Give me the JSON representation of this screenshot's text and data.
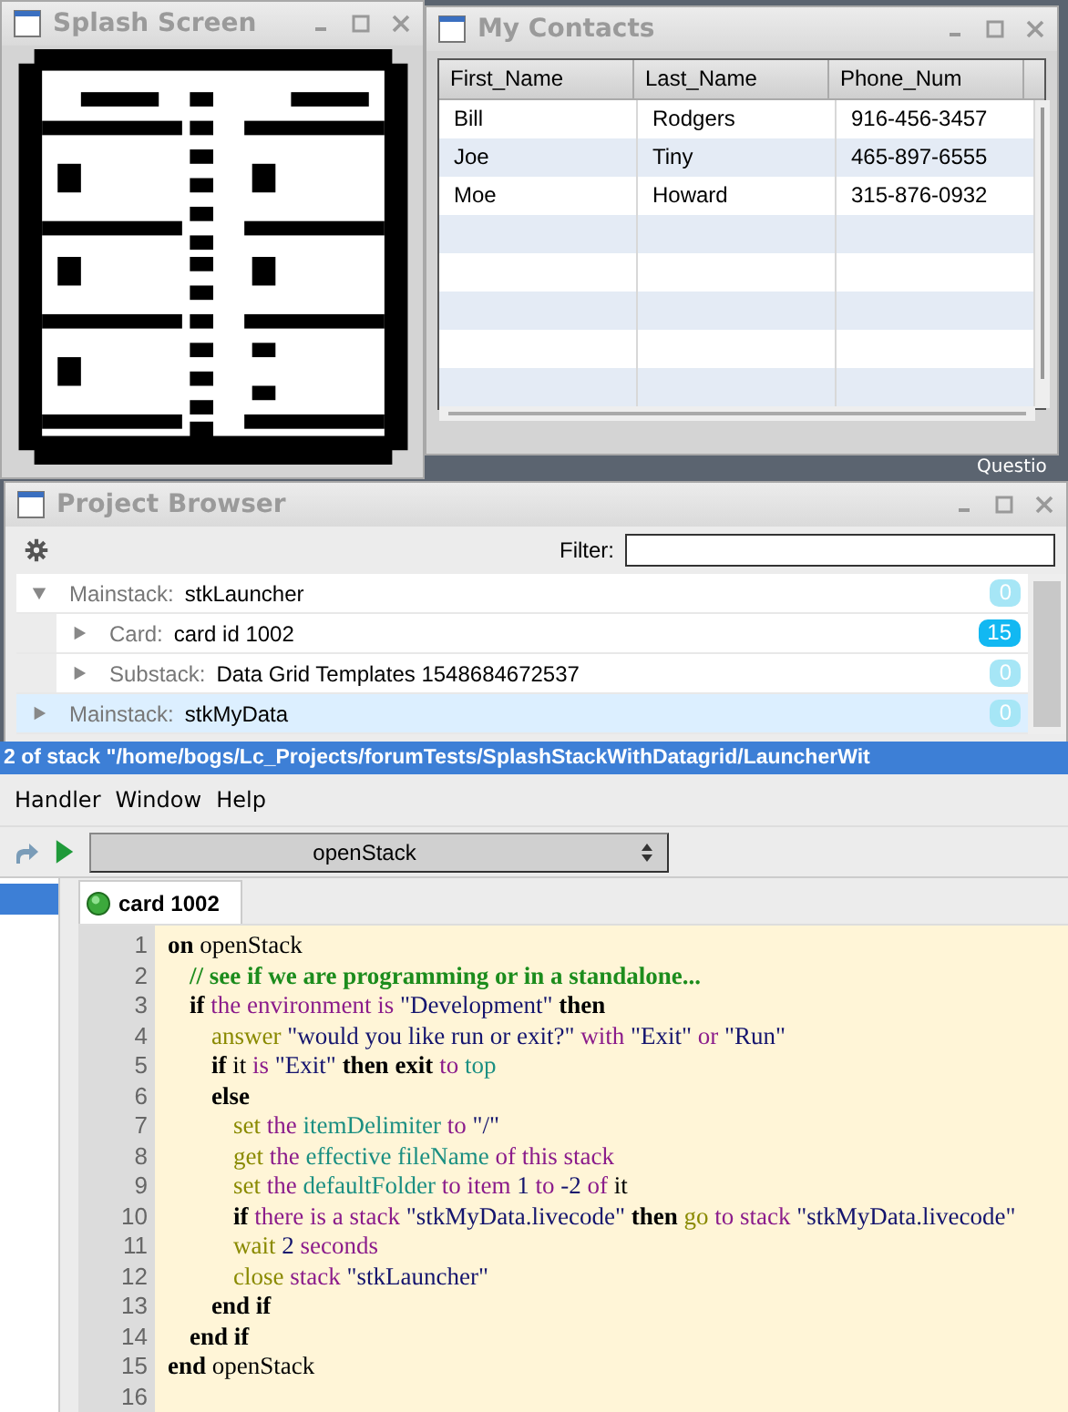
{
  "splash_window": {
    "title": "Splash Screen"
  },
  "contacts_window": {
    "title": "My Contacts",
    "table": {
      "columns": [
        "First_Name",
        "Last_Name",
        "Phone_Num"
      ],
      "rows": [
        [
          "Bill",
          "Rodgers",
          "916-456-3457"
        ],
        [
          "Joe",
          "Tiny",
          "465-897-6555"
        ],
        [
          "Moe",
          "Howard",
          "315-876-0932"
        ]
      ]
    }
  },
  "background_text": "Questio",
  "project_browser": {
    "title": "Project Browser",
    "filter_label": "Filter:",
    "tree": [
      {
        "type": "Mainstack:",
        "name": "stkLauncher",
        "count": "0",
        "color": "#a6e6f6",
        "expanded": true,
        "selected": false,
        "children": [
          {
            "type": "Card:",
            "name": "card id 1002",
            "count": "15",
            "color": "#12b8f2",
            "expanded": false,
            "selected": false
          },
          {
            "type": "Substack:",
            "name": "Data Grid Templates 1548684672537",
            "count": "0",
            "color": "#a6e6f6",
            "expanded": false,
            "selected": false
          }
        ]
      },
      {
        "type": "Mainstack:",
        "name": "stkMyData",
        "count": "0",
        "color": "#a6e6f6",
        "expanded": false,
        "selected": true
      }
    ]
  },
  "script_editor": {
    "title": "2 of stack \"/home/bogs/Lc_Projects/forumTests/SplashStackWithDatagrid/LauncherWit",
    "menu": [
      "Handler",
      "Window",
      "Help"
    ],
    "handler_dropdown": "openStack",
    "tab": "card 1002",
    "line_numbers": [
      "1",
      "2",
      "3",
      "4",
      "5",
      "6",
      "7",
      "8",
      "9",
      "10",
      "11",
      "12",
      "13",
      "14",
      "15",
      "16"
    ],
    "lines": [
      {
        "tokens": [
          {
            "text": "on",
            "kind": "kw"
          },
          {
            "text": " openStack",
            "kind": "plain"
          }
        ],
        "children": [
          {
            "tokens": [
              {
                "text": "// see if we are programming or in a standalone...",
                "kind": "cm"
              }
            ]
          },
          {
            "tokens": [
              {
                "text": "if",
                "kind": "kw"
              },
              {
                "text": " the environment is",
                "kind": "fn"
              },
              {
                "text": " \"Development\"",
                "kind": "str"
              },
              {
                "text": " then",
                "kind": "kw"
              }
            ],
            "children": [
              {
                "tokens": [
                  {
                    "text": "answer",
                    "kind": "cmd"
                  },
                  {
                    "text": " \"would you like run or exit?\"",
                    "kind": "str"
                  },
                  {
                    "text": " with",
                    "kind": "fn"
                  },
                  {
                    "text": " \"Exit\"",
                    "kind": "str"
                  },
                  {
                    "text": " or",
                    "kind": "fn"
                  },
                  {
                    "text": " \"Run\"",
                    "kind": "str"
                  }
                ]
              },
              {
                "tokens": [
                  {
                    "text": "if",
                    "kind": "kw"
                  },
                  {
                    "text": " it",
                    "kind": "plain"
                  },
                  {
                    "text": " is",
                    "kind": "fn"
                  },
                  {
                    "text": " \"Exit\"",
                    "kind": "str"
                  },
                  {
                    "text": " then exit",
                    "kind": "kw"
                  },
                  {
                    "text": " to",
                    "kind": "fn"
                  },
                  {
                    "text": " top",
                    "kind": "prop"
                  }
                ]
              },
              {
                "tokens": [
                  {
                    "text": "else",
                    "kind": "kw"
                  }
                ],
                "children": [
                  {
                    "tokens": [
                      {
                        "text": "set",
                        "kind": "cmd"
                      },
                      {
                        "text": " the",
                        "kind": "fn"
                      },
                      {
                        "text": " itemDelimiter",
                        "kind": "prop"
                      },
                      {
                        "text": " to",
                        "kind": "fn"
                      },
                      {
                        "text": " \"/\"",
                        "kind": "str"
                      }
                    ]
                  },
                  {
                    "tokens": [
                      {
                        "text": "get",
                        "kind": "cmd"
                      },
                      {
                        "text": " the",
                        "kind": "fn"
                      },
                      {
                        "text": " effective fileName",
                        "kind": "prop"
                      },
                      {
                        "text": " of this stack",
                        "kind": "fn"
                      }
                    ]
                  },
                  {
                    "tokens": [
                      {
                        "text": "set",
                        "kind": "cmd"
                      },
                      {
                        "text": " the",
                        "kind": "fn"
                      },
                      {
                        "text": " defaultFolder",
                        "kind": "prop"
                      },
                      {
                        "text": " to item",
                        "kind": "fn"
                      },
                      {
                        "text": " 1",
                        "kind": "str"
                      },
                      {
                        "text": " to",
                        "kind": "fn"
                      },
                      {
                        "text": " -2",
                        "kind": "str"
                      },
                      {
                        "text": " of",
                        "kind": "fn"
                      },
                      {
                        "text": " it",
                        "kind": "plain"
                      }
                    ]
                  },
                  {
                    "tokens": [
                      {
                        "text": "if",
                        "kind": "kw"
                      },
                      {
                        "text": " there is a stack",
                        "kind": "fn"
                      },
                      {
                        "text": " \"stkMyData.livecode\"",
                        "kind": "str"
                      },
                      {
                        "text": " then",
                        "kind": "kw"
                      },
                      {
                        "text": " go",
                        "kind": "cmd"
                      },
                      {
                        "text": " to stack",
                        "kind": "fn"
                      },
                      {
                        "text": " \"stkMyData.livecode\"",
                        "kind": "str"
                      }
                    ]
                  },
                  {
                    "tokens": [
                      {
                        "text": "wait",
                        "kind": "cmd"
                      },
                      {
                        "text": " 2",
                        "kind": "str"
                      },
                      {
                        "text": " seconds",
                        "kind": "fn"
                      }
                    ]
                  },
                  {
                    "tokens": [
                      {
                        "text": "close",
                        "kind": "cmd"
                      },
                      {
                        "text": " stack",
                        "kind": "fn"
                      },
                      {
                        "text": " \"stkLauncher\"",
                        "kind": "str"
                      }
                    ]
                  }
                ]
              },
              {
                "tokens": [
                  {
                    "text": "end if",
                    "kind": "kw"
                  }
                ]
              }
            ]
          },
          {
            "tokens": [
              {
                "text": "end if",
                "kind": "kw"
              }
            ]
          }
        ]
      },
      {
        "tokens": [
          {
            "text": "end",
            "kind": "kw"
          },
          {
            "text": " openStack",
            "kind": "plain"
          }
        ]
      }
    ]
  }
}
